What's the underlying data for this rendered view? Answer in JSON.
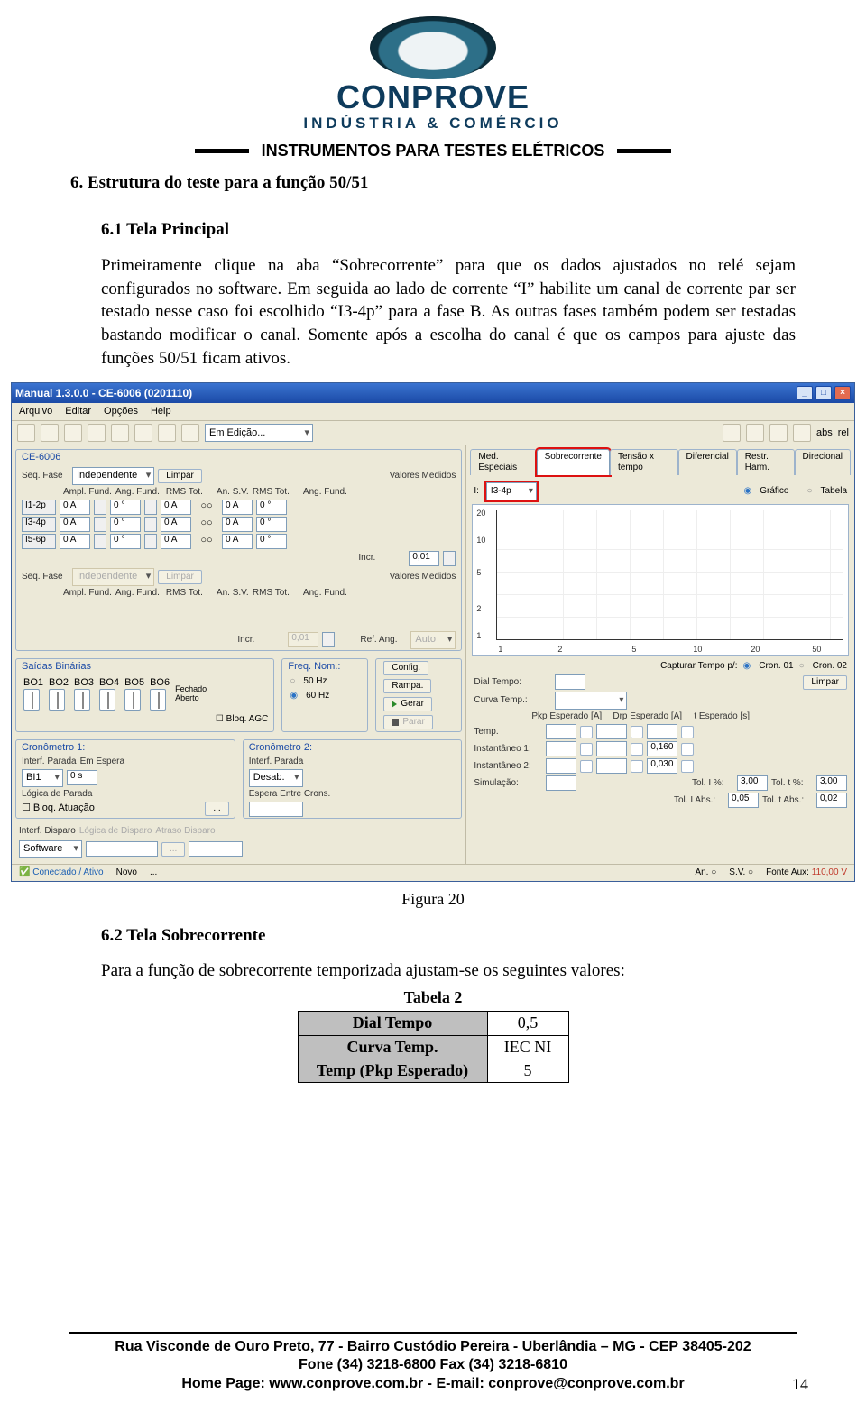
{
  "header": {
    "logo_name": "CONPROVE",
    "logo_sub": "INDÚSTRIA & COMÉRCIO",
    "bar_title": "INSTRUMENTOS PARA TESTES ELÉTRICOS"
  },
  "section": {
    "h1": "6.  Estrutura do teste para a função 50/51",
    "h2_1": "6.1 Tela Principal",
    "para1": "Primeiramente clique na aba “Sobrecorrente” para que os dados ajustados no relé sejam configurados no software. Em seguida ao lado de corrente “I” habilite um canal de corrente par ser testado nesse caso foi escolhido “I3-4p” para a fase B. As outras fases também podem ser testadas bastando modificar o canal. Somente após a escolha do canal é que os campos para ajuste das funções 50/51 ficam ativos.",
    "caption1": "Figura 20",
    "h2_2": "6.2 Tela Sobrecorrente",
    "para2": "Para a função de sobrecorrente temporizada ajustam-se os seguintes valores:"
  },
  "shot": {
    "title": "Manual 1.3.0.0 - CE-6006 (0201110)",
    "menu": [
      "Arquivo",
      "Editar",
      "Opções",
      "Help"
    ],
    "editing": "Em Edição...",
    "toolbar_right": [
      "abs",
      "rel"
    ],
    "device_panel": "CE-6006",
    "seq_fase_label": "Seq. Fase",
    "seq_fase_val": "Independente",
    "limpar": "Limpar",
    "cols": [
      "Ampl. Fund.",
      "Ang. Fund.",
      "RMS Tot.",
      "An. S.V.",
      "RMS Tot.",
      "Ang. Fund."
    ],
    "ch": [
      {
        "name": "I1-2p",
        "a": "0 A",
        "b": "0 °",
        "c": "0 A",
        "d": "0 A",
        "e": "0 °"
      },
      {
        "name": "I3-4p",
        "a": "0 A",
        "b": "0 °",
        "c": "0 A",
        "d": "0 A",
        "e": "0 °"
      },
      {
        "name": "I5-6p",
        "a": "0 A",
        "b": "0 °",
        "c": "0 A",
        "d": "0 A",
        "e": "0 °"
      }
    ],
    "valores_medidos": "Valores Medidos",
    "incr_label": "Incr.",
    "incr_val": "0,01",
    "refang_label": "Ref. Ang.",
    "refang_val": "Auto",
    "saidas": {
      "title": "Saídas Binárias",
      "items": [
        "BO1",
        "BO2",
        "BO3",
        "BO4",
        "BO5",
        "BO6"
      ],
      "fechado": "Fechado",
      "aberto": "Aberto",
      "bloq": "Bloq. AGC"
    },
    "freq": {
      "title": "Freq. Nom.:",
      "o50": "50 Hz",
      "o60": "60 Hz"
    },
    "cmds": {
      "config": "Config.",
      "rampa": "Rampa.",
      "gerar": "Gerar",
      "parar": "Parar"
    },
    "cron1": {
      "title": "Cronômetro 1:",
      "interf": "Interf. Parada",
      "espera": "Em Espera",
      "bi": "BI1",
      "t": "0 s",
      "logica": "Lógica de Parada",
      "bloq": "Bloq. Atuação"
    },
    "cron2": {
      "title": "Cronômetro 2:",
      "interf": "Interf. Parada",
      "desab": "Desab.",
      "espera": "Espera Entre Crons."
    },
    "disp": {
      "interf": "Interf. Disparo",
      "logica": "Lógica de Disparo",
      "atraso": "Atraso Disparo",
      "sw": "Software"
    },
    "tabs": [
      "Med. Especiais",
      "Sobrecorrente",
      "Tensão x tempo",
      "Diferencial",
      "Restr. Harm.",
      "Direcional"
    ],
    "i_label": "I:",
    "i_val": "I3-4p",
    "view": {
      "grafico": "Gráfico",
      "tabela": "Tabela"
    },
    "chart": {
      "y": [
        "20",
        "10",
        "5",
        "2",
        "1"
      ],
      "x": [
        "1",
        "2",
        "5",
        "10",
        "20",
        "50"
      ]
    },
    "cap": {
      "label": "Capturar Tempo p/:",
      "c1": "Cron. 01",
      "c2": "Cron. 02"
    },
    "params": {
      "dial": "Dial Tempo:",
      "curva": "Curva Temp.:",
      "pkp": "Pkp Esperado [A]",
      "drp": "Drp Esperado [A]",
      "tesp": "t Esperado [s]",
      "temp": "Temp.",
      "inst1": "Instantâneo 1:",
      "inst2": "Instantâneo 2:",
      "sim": "Simulação:",
      "v_inst1": "0,160",
      "v_inst2": "0,030",
      "tolI": "Tol. I %:",
      "tolI_v": "3,00",
      "tolt": "Tol. t %:",
      "tolt_v": "3,00",
      "tolIa": "Tol. I Abs.:",
      "tolIa_v": "0,05",
      "tolta": "Tol. t Abs.:",
      "tolta_v": "0,02",
      "limpar": "Limpar"
    },
    "status": {
      "conn": "Conectado / Ativo",
      "novo": "Novo",
      "an": "An.",
      "sv": "S.V.",
      "fonte": "Fonte Aux:",
      "fonte_v": "110,00 V"
    }
  },
  "tabela2": {
    "cap": "Tabela 2",
    "rows": [
      [
        "Dial Tempo",
        "0,5"
      ],
      [
        "Curva Temp.",
        "IEC NI"
      ],
      [
        "Temp (Pkp Esperado)",
        "5"
      ]
    ]
  },
  "footer": {
    "l1": "Rua Visconde de Ouro Preto, 77 -  Bairro Custódio Pereira - Uberlândia – MG -  CEP 38405-202",
    "l2": "Fone (34) 3218-6800          Fax (34) 3218-6810",
    "l3": "Home Page: www.conprove.com.br     -     E-mail: conprove@conprove.com.br",
    "page": "14"
  }
}
